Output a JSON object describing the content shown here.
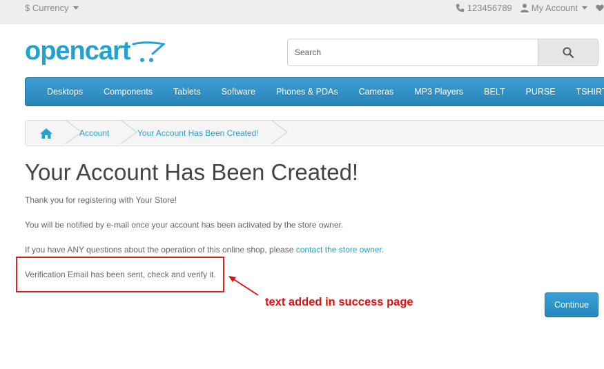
{
  "topbar": {
    "currency_label": "$ Currency",
    "phone": "123456789",
    "my_account": "My Account"
  },
  "logo": {
    "text": "opencart"
  },
  "search": {
    "placeholder": "Search"
  },
  "menu": {
    "items": [
      "Desktops",
      "Components",
      "Tablets",
      "Software",
      "Phones & PDAs",
      "Cameras",
      "MP3 Players",
      "BELT",
      "PURSE",
      "TSHIRT"
    ]
  },
  "breadcrumb": {
    "items": [
      "Account",
      "Your Account Has Been Created!"
    ]
  },
  "content": {
    "title": "Your Account Has Been Created!",
    "p1": "Thank you for registering with Your Store!",
    "p2": "You will be notified by e-mail once your account has been activated by the store owner.",
    "p3_text": "If you have ANY questions about the operation of this online shop, please ",
    "p3_link": "contact the store owner.",
    "p4": "Verification Email has been sent, check and verify it."
  },
  "annotation": {
    "text": "text added in success page"
  },
  "buttons": {
    "continue": "Continue"
  },
  "colors": {
    "link": "#23a1d1",
    "menu": "#2c8fc4",
    "annotation": "#e01010"
  }
}
